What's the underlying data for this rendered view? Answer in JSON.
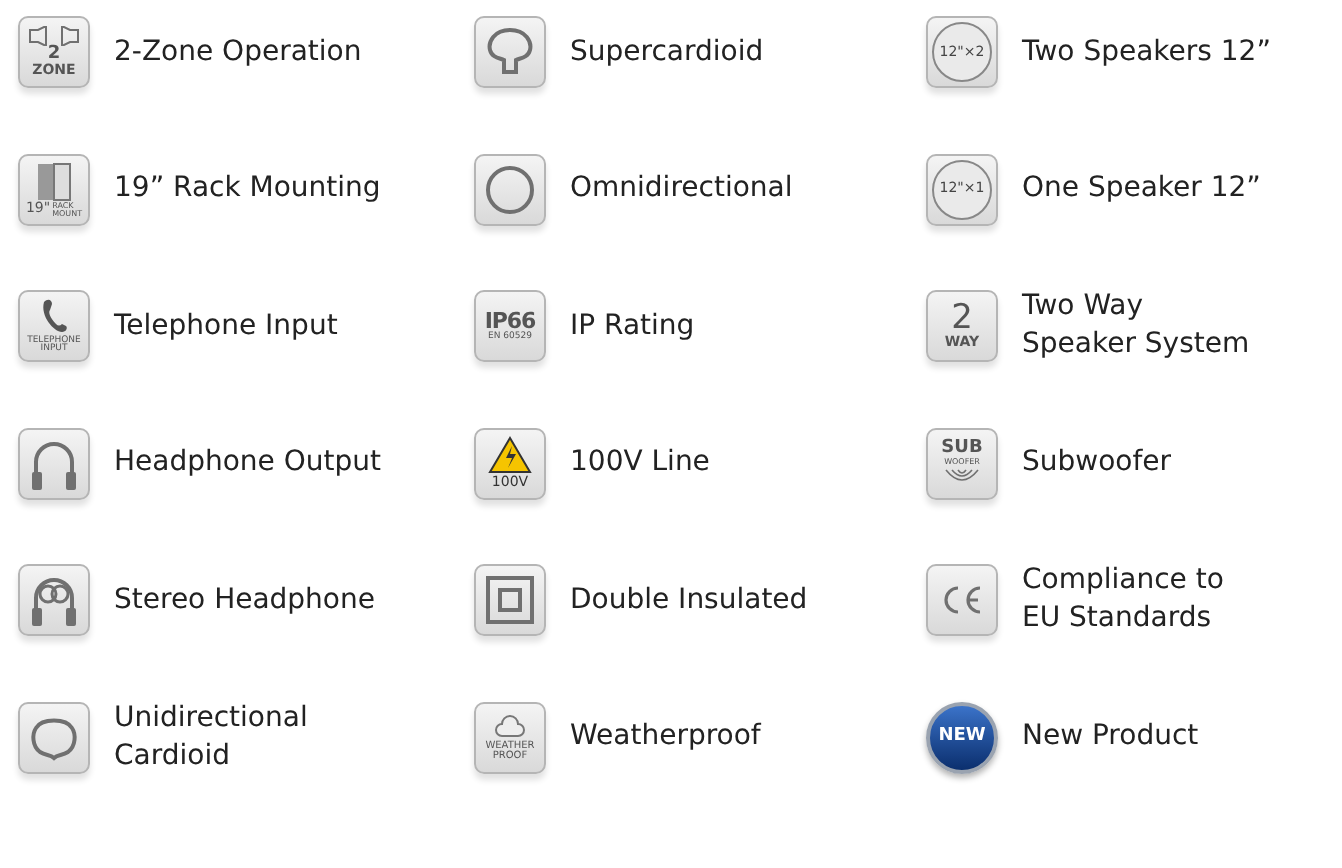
{
  "features": [
    {
      "kind": "zone",
      "label": "2-Zone Operation",
      "badge": [
        "2",
        "ZONE"
      ]
    },
    {
      "kind": "supercardioid",
      "label": "Supercardioid"
    },
    {
      "kind": "speaker",
      "label": "Two Speakers 12”",
      "badge": [
        "12\"×2"
      ]
    },
    {
      "kind": "rack",
      "label": "19” Rack Mounting",
      "badge": [
        "19\"",
        "RACK",
        "MOUNT"
      ]
    },
    {
      "kind": "omni",
      "label": "Omnidirectional"
    },
    {
      "kind": "speaker",
      "label": "One Speaker 12”",
      "badge": [
        "12\"×1"
      ]
    },
    {
      "kind": "telephone",
      "label": "Telephone Input",
      "badge": [
        "TELEPHONE",
        "INPUT"
      ]
    },
    {
      "kind": "ip",
      "label": "IP Rating",
      "badge": [
        "IP66",
        "EN 60529"
      ]
    },
    {
      "kind": "twoway",
      "label": "Two Way\nSpeaker System",
      "badge": [
        "2",
        "WAY"
      ]
    },
    {
      "kind": "headphone",
      "label": "Headphone Output"
    },
    {
      "kind": "warning",
      "label": "100V Line",
      "badge": [
        "100V"
      ]
    },
    {
      "kind": "subwoofer",
      "label": "Subwoofer",
      "badge": [
        "SUB",
        "WOOFER"
      ]
    },
    {
      "kind": "stereo",
      "label": "Stereo Headphone"
    },
    {
      "kind": "double",
      "label": "Double Insulated"
    },
    {
      "kind": "ce",
      "label": "Compliance to\nEU Standards"
    },
    {
      "kind": "cardioid",
      "label": "Unidirectional\nCardioid"
    },
    {
      "kind": "weather",
      "label": "Weatherproof",
      "badge": [
        "WEATHER",
        "PROOF"
      ]
    },
    {
      "kind": "new",
      "label": "New Product",
      "badge": [
        "NEW"
      ]
    }
  ]
}
